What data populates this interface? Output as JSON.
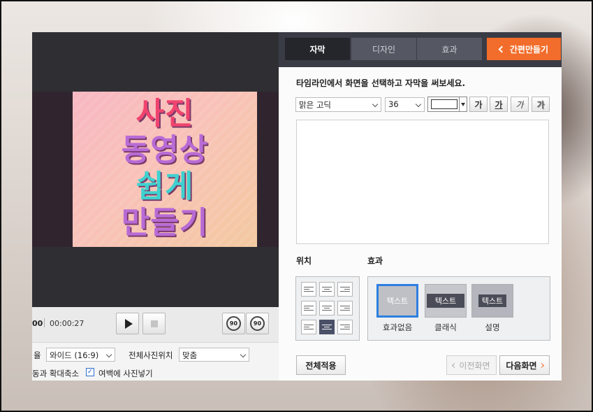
{
  "preview": {
    "lines": [
      "사진",
      "동영상",
      "쉽게",
      "만들기"
    ]
  },
  "player": {
    "time_current": "00",
    "time_total": "00:00:27",
    "play_icon": "play-icon",
    "stop_icon": "stop-icon",
    "rotate_left_label": "90",
    "rotate_right_label": "90"
  },
  "options": {
    "ratio_label": "율",
    "ratio_value": "와이드 (16:9)",
    "position_label": "전체사진위치",
    "position_value": "맞춤",
    "motion_label": "동과 확대축소",
    "fill_checked": true,
    "fill_label": "여백에 사진넣기"
  },
  "tabs": [
    {
      "label": "자막",
      "active": true
    },
    {
      "label": "디자인",
      "active": false
    },
    {
      "label": "효과",
      "active": false
    }
  ],
  "quick_button": "간편만들기",
  "instruction": "타임라인에서 화면을 선택하고 자막을 써보세요.",
  "font": {
    "family": "맑은 고딕",
    "size": "36",
    "text_color": "#ffffff",
    "style_buttons": [
      "가",
      "가",
      "가",
      "가"
    ]
  },
  "sections": {
    "position": "위치",
    "effect": "효과"
  },
  "effects": [
    {
      "chip": "텍스트",
      "label": "효과없음",
      "selected": true
    },
    {
      "chip": "텍스트",
      "label": "클래식",
      "selected": false
    },
    {
      "chip": "텍스트",
      "label": "설명",
      "selected": false
    }
  ],
  "buttons": {
    "apply_all": "전체적용",
    "prev": "이전화면",
    "next": "다음화면"
  },
  "colors": {
    "accent": "#f26d2b",
    "tab_bar": "#3a3c45",
    "selection": "#2d7fe0"
  }
}
